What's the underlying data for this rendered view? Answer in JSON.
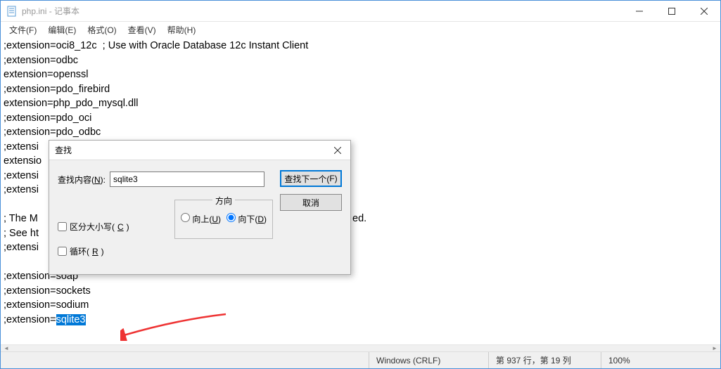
{
  "window": {
    "title": "php.ini - 记事本"
  },
  "menu": {
    "file": "文件(F)",
    "edit": "编辑(E)",
    "format": "格式(O)",
    "view": "查看(V)",
    "help": "帮助(H)"
  },
  "editor": {
    "lines": [
      ";extension=oci8_12c  ; Use with Oracle Database 12c Instant Client",
      ";extension=odbc",
      "extension=openssl",
      ";extension=pdo_firebird",
      "extension=php_pdo_mysql.dll",
      ";extension=pdo_oci",
      ";extension=pdo_odbc",
      ";extensi",
      "extensio",
      ";extensi",
      ";extensi",
      "",
      "; The M",
      "; See ht",
      ";extensi",
      "",
      ";extension=soap",
      ";extension=sockets",
      ";extension=sodium"
    ],
    "highlight_prefix": ";extension=",
    "highlight_text": "sqlite3",
    "truncated_right": "ed."
  },
  "dialog": {
    "title": "查找",
    "find_label_pre": "查找内容(",
    "find_label_key": "N",
    "find_label_post": "):",
    "input_value": "sqlite3",
    "direction_label": "方向",
    "up_pre": "向上(",
    "up_key": "U",
    "up_post": ")",
    "down_pre": "向下(",
    "down_key": "D",
    "down_post": ")",
    "case_pre": "区分大小写(",
    "case_key": "C",
    "case_post": ")",
    "wrap_pre": "循环(",
    "wrap_key": "R",
    "wrap_post": ")",
    "find_next_pre": "查找下一个(",
    "find_next_key": "F",
    "find_next_post": ")",
    "cancel": "取消"
  },
  "status": {
    "encoding": "Windows (CRLF)",
    "position": "第 937 行，第 19 列",
    "zoom": "100%"
  }
}
